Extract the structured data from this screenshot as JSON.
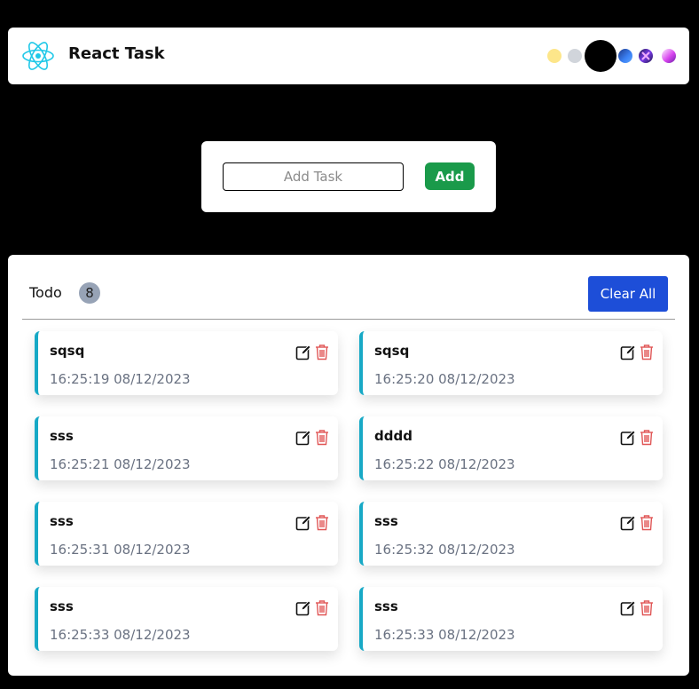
{
  "header": {
    "title": "React Task",
    "theme_dots": [
      {
        "name": "theme-dot-yellow",
        "color": "#fde68a"
      },
      {
        "name": "theme-dot-gray",
        "color": "#d1d5db"
      },
      {
        "name": "theme-dot-black",
        "color": "#000000"
      },
      {
        "name": "theme-dot-blue-gradient",
        "color": "#2563eb"
      },
      {
        "name": "theme-dot-purple-gradient",
        "color": "#7c3aed"
      },
      {
        "name": "theme-dot-pink-gradient",
        "color": "#db2777"
      }
    ]
  },
  "add_task": {
    "placeholder": "Add Task",
    "button_label": "Add"
  },
  "todo": {
    "label": "Todo",
    "count": "8",
    "clear_label": "Clear All",
    "tasks": [
      {
        "title": "sqsq",
        "time": "16:25:19 08/12/2023"
      },
      {
        "title": "sqsq",
        "time": "16:25:20 08/12/2023"
      },
      {
        "title": "sss",
        "time": "16:25:21 08/12/2023"
      },
      {
        "title": "dddd",
        "time": "16:25:22 08/12/2023"
      },
      {
        "title": "sss",
        "time": "16:25:31 08/12/2023"
      },
      {
        "title": "sss",
        "time": "16:25:32 08/12/2023"
      },
      {
        "title": "sss",
        "time": "16:25:33 08/12/2023"
      },
      {
        "title": "sss",
        "time": "16:25:33 08/12/2023"
      }
    ]
  },
  "colors": {
    "accent_border": "#17a9c6",
    "add_button": "#1a9a4a",
    "clear_button": "#1d4ed8",
    "delete_icon": "#e05656"
  }
}
